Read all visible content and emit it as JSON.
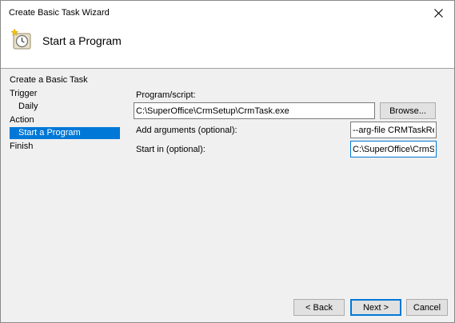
{
  "window": {
    "title": "Create Basic Task Wizard",
    "close_glyph": "✕"
  },
  "header": {
    "title": "Start a Program",
    "icon": "task-scheduler-clock-icon"
  },
  "sidebar": {
    "items": [
      {
        "label": "Create a Basic Task",
        "selected": false
      },
      {
        "label": "Trigger",
        "selected": false
      },
      {
        "label": "Daily",
        "selected": false
      },
      {
        "label": "Action",
        "selected": false
      },
      {
        "label": "Start a Program",
        "selected": true
      },
      {
        "label": "Finish",
        "selected": false
      }
    ]
  },
  "form": {
    "program_label": "Program/script:",
    "program_value": "C:\\SuperOffice\\CrmSetup\\CrmTask.exe",
    "browse_label": "Browse...",
    "args_label": "Add arguments (optional):",
    "args_value": "--arg-file CRMTaskRegen",
    "startin_label": "Start in (optional):",
    "startin_value": "C:\\SuperOffice\\CrmSetup"
  },
  "footer": {
    "back_label": "< Back",
    "next_label": "Next >",
    "cancel_label": "Cancel"
  },
  "colors": {
    "accent": "#0078d7",
    "window_bg": "#f0f0f0"
  }
}
